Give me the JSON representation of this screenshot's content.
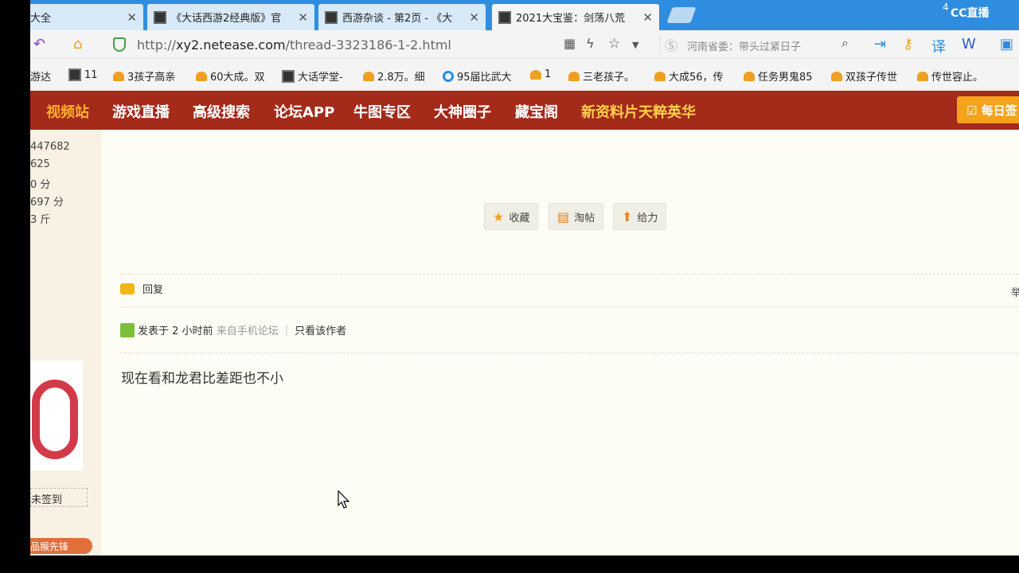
{
  "tabs": [
    {
      "label": "大全",
      "active": false
    },
    {
      "label": "《大话西游2经典版》官",
      "active": false
    },
    {
      "label": "西游杂谈 - 第2页 - 《大",
      "active": false
    },
    {
      "label": "2021大宝鉴：剑荡八荒",
      "active": true
    }
  ],
  "tab_close": "✕",
  "overlay": {
    "logo": "CC直播",
    "badge_num": "4"
  },
  "address": {
    "url_prefix": "http://",
    "url_domain": "xy2.netease.com",
    "url_path": "/thread-3323186-1-2.html",
    "search_text": "河南省委：带头过紧日子"
  },
  "bookmarks": [
    "游达",
    "11",
    "3孩子高亲",
    "60大成。双",
    "大话学堂-",
    "2.8万。细",
    "95届比武大",
    "1",
    "三老孩子。",
    "大成56，传",
    "任务男鬼85",
    "双孩子传世",
    "传世容止。"
  ],
  "site_nav": [
    "视频站",
    "游戏直播",
    "高级搜索",
    "论坛APP",
    "牛图专区",
    "大神圈子",
    "藏宝阁",
    "新资料片天粹英华"
  ],
  "signin_label": "每日签",
  "profile_stats": [
    "447682",
    "625",
    "0 分",
    "697 分",
    "3 斤"
  ],
  "profile_sign": "未签到",
  "profile_vip": "品猴先锋",
  "actions": {
    "favorite": "收藏",
    "hot": "淘帖",
    "support": "给力"
  },
  "reply_label": "回复",
  "floor_label": "举",
  "post": {
    "posted_prefix": "发表于",
    "time": "2 小时前",
    "source": "来自手机论坛",
    "author_only": "只看该作者",
    "body": "现在看和龙君比差距也不小"
  },
  "colors": {
    "tabbar": "#2e8de0",
    "sitenav": "#a42a1a",
    "accent": "#f5a21c"
  }
}
